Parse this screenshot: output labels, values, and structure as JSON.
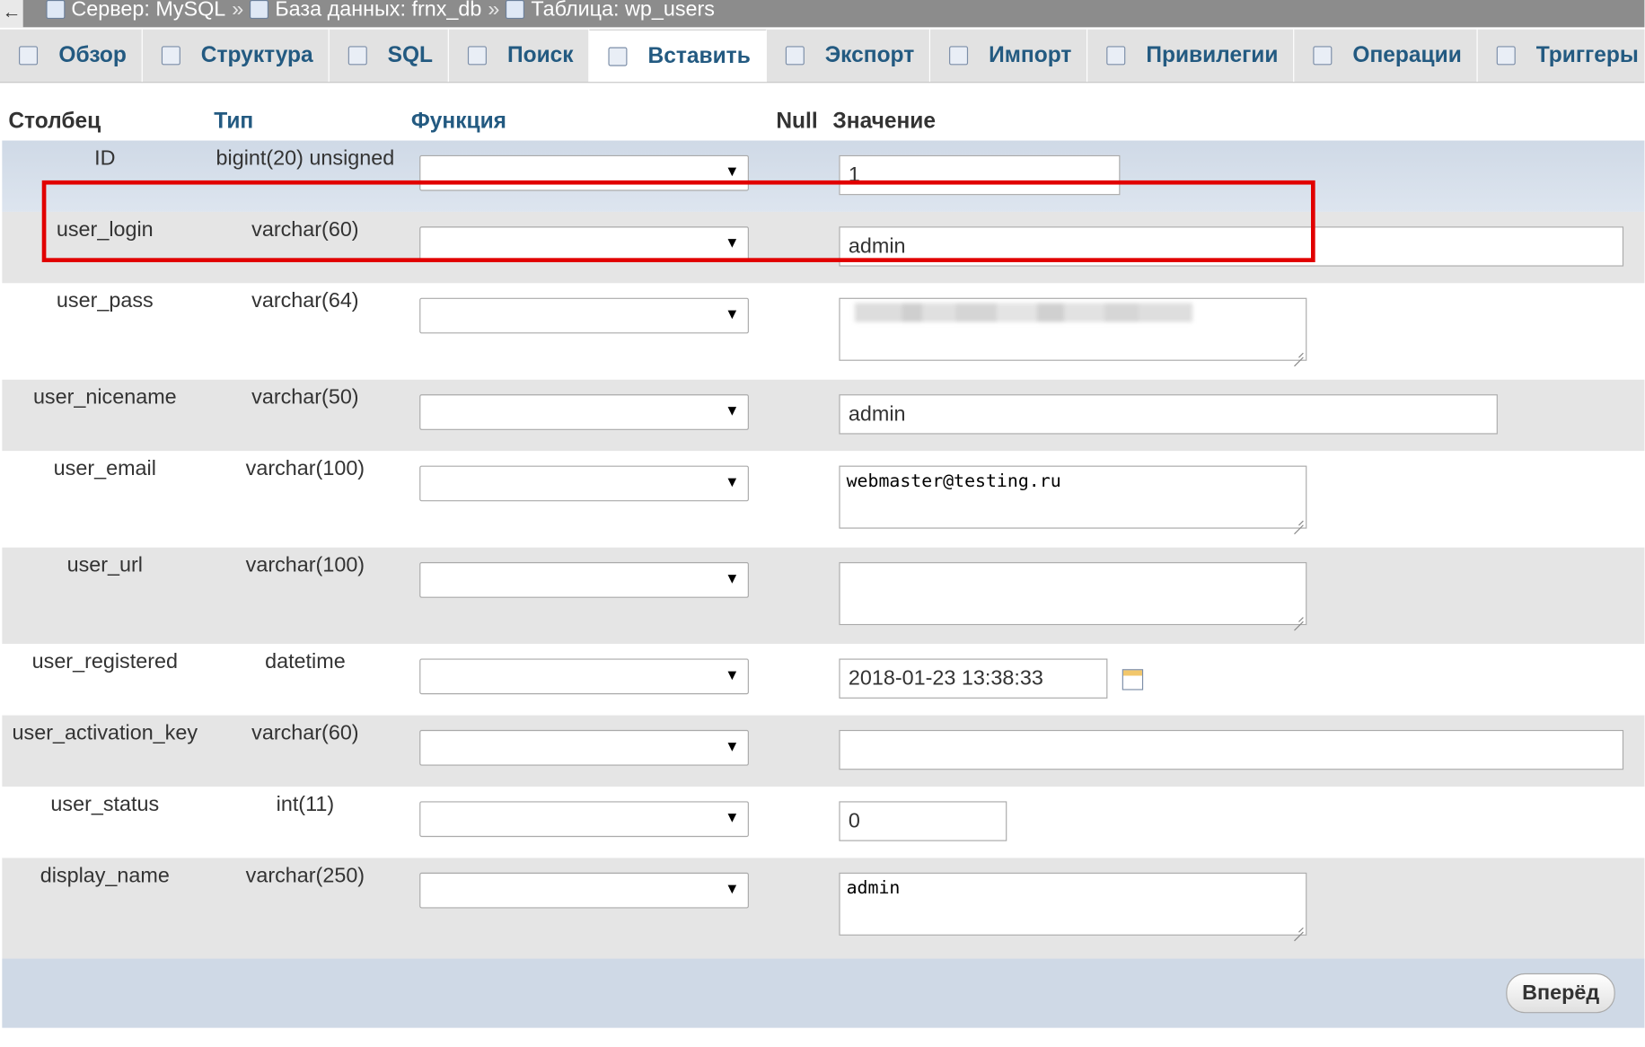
{
  "breadcrumb": {
    "back": "←",
    "server": "Сервер: MySQL",
    "database": "База данных: frnx_db",
    "table": "Таблица: wp_users",
    "separator": "»"
  },
  "tabs": [
    {
      "label": "Обзор",
      "icon": "browse-icon",
      "active": false
    },
    {
      "label": "Структура",
      "icon": "structure-icon",
      "active": false
    },
    {
      "label": "SQL",
      "icon": "sql-icon",
      "active": false
    },
    {
      "label": "Поиск",
      "icon": "search-icon",
      "active": false
    },
    {
      "label": "Вставить",
      "icon": "insert-icon",
      "active": true
    },
    {
      "label": "Экспорт",
      "icon": "export-icon",
      "active": false
    },
    {
      "label": "Импорт",
      "icon": "import-icon",
      "active": false
    },
    {
      "label": "Привилегии",
      "icon": "privileges-icon",
      "active": false
    },
    {
      "label": "Операции",
      "icon": "operations-icon",
      "active": false
    },
    {
      "label": "Триггеры",
      "icon": "triggers-icon",
      "active": false
    }
  ],
  "headers": {
    "column": "Столбец",
    "type": "Тип",
    "function": "Функция",
    "null": "Null",
    "value": "Значение"
  },
  "rows": [
    {
      "name": "ID",
      "type": "bigint(20) unsigned",
      "value": "1"
    },
    {
      "name": "user_login",
      "type": "varchar(60)",
      "value": "admin"
    },
    {
      "name": "user_pass",
      "type": "varchar(64)",
      "value": ""
    },
    {
      "name": "user_nicename",
      "type": "varchar(50)",
      "value": "admin"
    },
    {
      "name": "user_email",
      "type": "varchar(100)",
      "value": "webmaster@testing.ru"
    },
    {
      "name": "user_url",
      "type": "varchar(100)",
      "value": ""
    },
    {
      "name": "user_registered",
      "type": "datetime",
      "value": "2018-01-23 13:38:33"
    },
    {
      "name": "user_activation_key",
      "type": "varchar(60)",
      "value": ""
    },
    {
      "name": "user_status",
      "type": "int(11)",
      "value": "0"
    },
    {
      "name": "display_name",
      "type": "varchar(250)",
      "value": "admin"
    }
  ],
  "select_arrow": "▼",
  "go_button": "Вперёд",
  "highlight_color": "#e10000"
}
